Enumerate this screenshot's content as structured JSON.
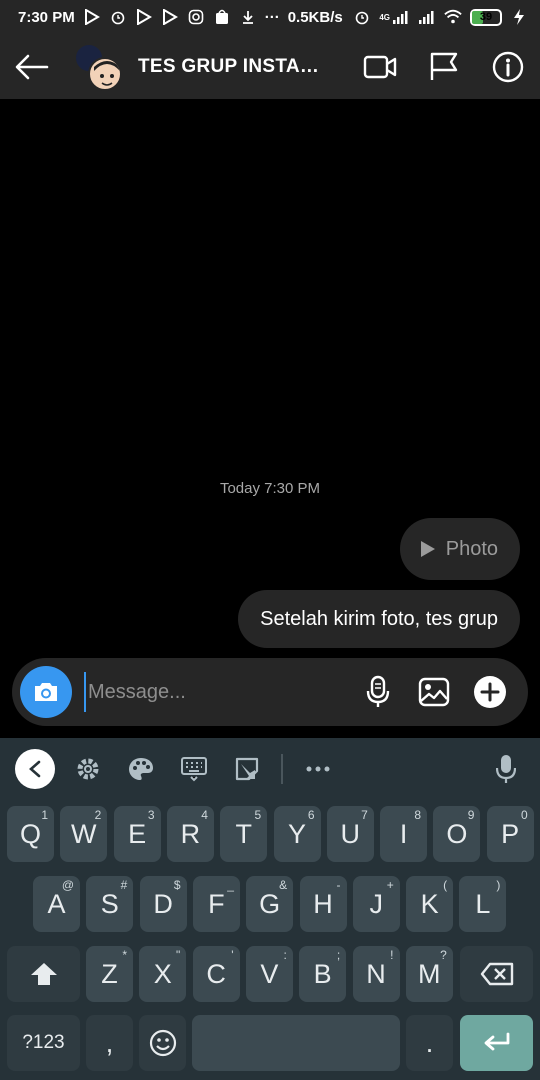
{
  "status_bar": {
    "time": "7:30 PM",
    "speed": "0.5KB/s",
    "network": "4G",
    "battery": 39,
    "icons": [
      "play-store-icon",
      "alarm-icon",
      "play-store-icon",
      "play-store-icon",
      "instagram-icon",
      "shopee-icon",
      "download-icon",
      "more-dots-icon"
    ]
  },
  "header": {
    "title": "TES GRUP INSTAS...",
    "back_icon": "arrow-left-icon",
    "actions": [
      "video-call-icon",
      "flag-icon",
      "info-icon"
    ]
  },
  "chat": {
    "timestamp": "Today 7:30 PM",
    "messages": [
      {
        "type": "photo",
        "label": "Photo"
      },
      {
        "type": "text",
        "text": "Setelah kirim foto, tes grup"
      }
    ]
  },
  "composer": {
    "placeholder": "Message...",
    "camera_icon": "camera-icon",
    "icons": [
      "microphone-icon",
      "gallery-icon",
      "plus-circle-icon"
    ],
    "accent": "#3797f0"
  },
  "keyboard": {
    "toolbar": [
      "back-icon",
      "settings-icon",
      "palette-icon",
      "keyboard-icon",
      "sticker-icon",
      "more-icon",
      "microphone-icon"
    ],
    "row1": [
      {
        "k": "Q",
        "h": "1"
      },
      {
        "k": "W",
        "h": "2"
      },
      {
        "k": "E",
        "h": "3"
      },
      {
        "k": "R",
        "h": "4"
      },
      {
        "k": "T",
        "h": "5"
      },
      {
        "k": "Y",
        "h": "6"
      },
      {
        "k": "U",
        "h": "7"
      },
      {
        "k": "I",
        "h": "8"
      },
      {
        "k": "O",
        "h": "9"
      },
      {
        "k": "P",
        "h": "0"
      }
    ],
    "row2": [
      {
        "k": "A",
        "h": "@"
      },
      {
        "k": "S",
        "h": "#"
      },
      {
        "k": "D",
        "h": "$"
      },
      {
        "k": "F",
        "h": "_"
      },
      {
        "k": "G",
        "h": "&"
      },
      {
        "k": "H",
        "h": "-"
      },
      {
        "k": "J",
        "h": "+"
      },
      {
        "k": "K",
        "h": "("
      },
      {
        "k": "L",
        "h": ")"
      }
    ],
    "row3": [
      {
        "k": "Z",
        "h": "*"
      },
      {
        "k": "X",
        "h": "\""
      },
      {
        "k": "C",
        "h": "'"
      },
      {
        "k": "V",
        "h": ":"
      },
      {
        "k": "B",
        "h": ";"
      },
      {
        "k": "N",
        "h": "!"
      },
      {
        "k": "M",
        "h": "?"
      }
    ],
    "sym_label": "?123",
    "comma": ",",
    "period": ".",
    "enter_color": "#6fa8a0"
  }
}
